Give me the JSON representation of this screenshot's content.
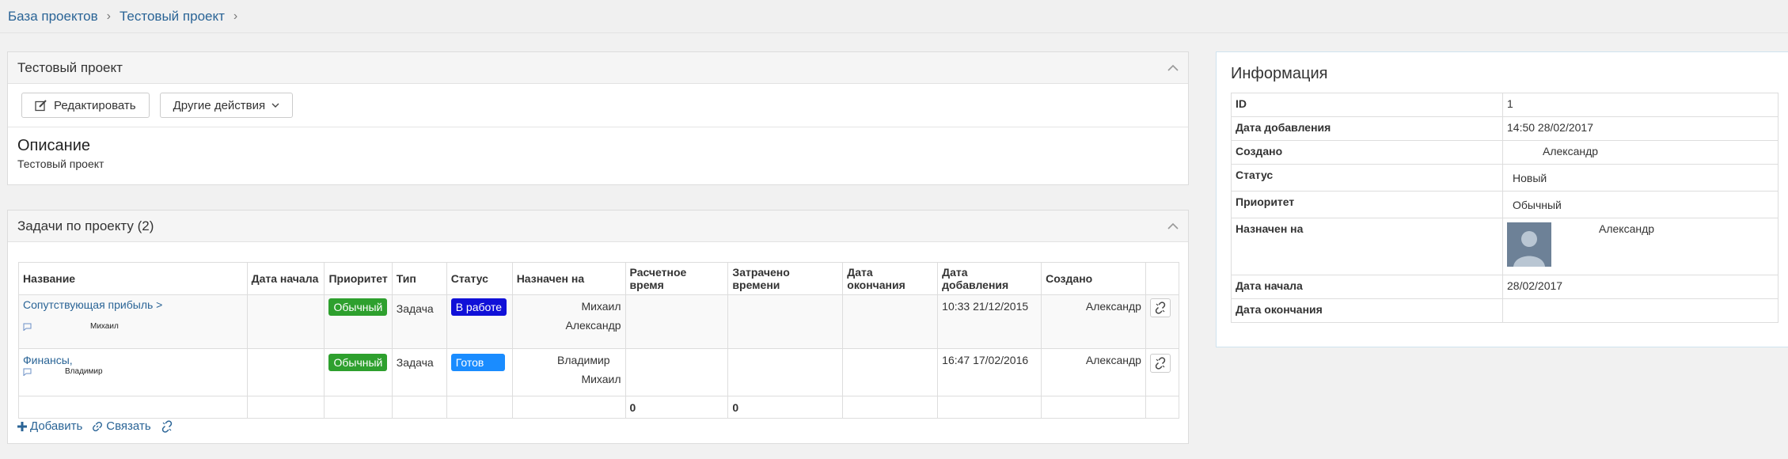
{
  "breadcrumb": {
    "items": [
      "База проектов",
      "Тестовый проект"
    ],
    "sep": "›"
  },
  "project_panel": {
    "title": "Тестовый проект",
    "edit_label": "Редактировать",
    "other_actions_label": "Другие действия",
    "description_heading": "Описание",
    "description_text": "Тестовый проект"
  },
  "tasks_panel": {
    "title": "Задачи по проекту (2)",
    "columns": [
      "Название",
      "Дата начала",
      "Приоритет",
      "Тип",
      "Статус",
      "Назначен на",
      "Расчетное время",
      "Затрачено времени",
      "Дата окончания",
      "Дата добавления",
      "Создано"
    ],
    "rows": [
      {
        "name": "Сопутствующая прибыль >",
        "comment_author": "Михаил",
        "priority": "Обычный",
        "type": "Задача",
        "status": "В работе",
        "assignee_1": "Михаил",
        "assignee_2": "Александр",
        "added": "10:33 21/12/2015",
        "created_by": "Александр"
      },
      {
        "name": "Финансы,",
        "comment_author": "Владимир",
        "priority": "Обычный",
        "type": "Задача",
        "status": "Готов",
        "assignee_1": "Владимир",
        "assignee_2": "Михаил",
        "added": "16:47 17/02/2016",
        "created_by": "Александр"
      }
    ],
    "totals": {
      "estimated": "0",
      "spent": "0"
    },
    "add_label": "Добавить",
    "link_label": "Связать"
  },
  "info_panel": {
    "title": "Информация",
    "rows": [
      {
        "key": "ID",
        "value": "1"
      },
      {
        "key": "Дата добавления",
        "value": "14:50 28/02/2017"
      },
      {
        "key": "Создано",
        "value": "Александр"
      },
      {
        "key": "Статус",
        "value": "Новый"
      },
      {
        "key": "Приоритет",
        "value": "Обычный"
      },
      {
        "key": "Назначен на",
        "value": "Александр"
      },
      {
        "key": "Дата начала",
        "value": "28/02/2017"
      },
      {
        "key": "Дата окончания",
        "value": ""
      }
    ]
  },
  "colors": {
    "priority_normal": "#2ea02e",
    "status_in_progress": "#1010d8",
    "status_ready": "#1a8cff",
    "link": "#2a6496"
  }
}
